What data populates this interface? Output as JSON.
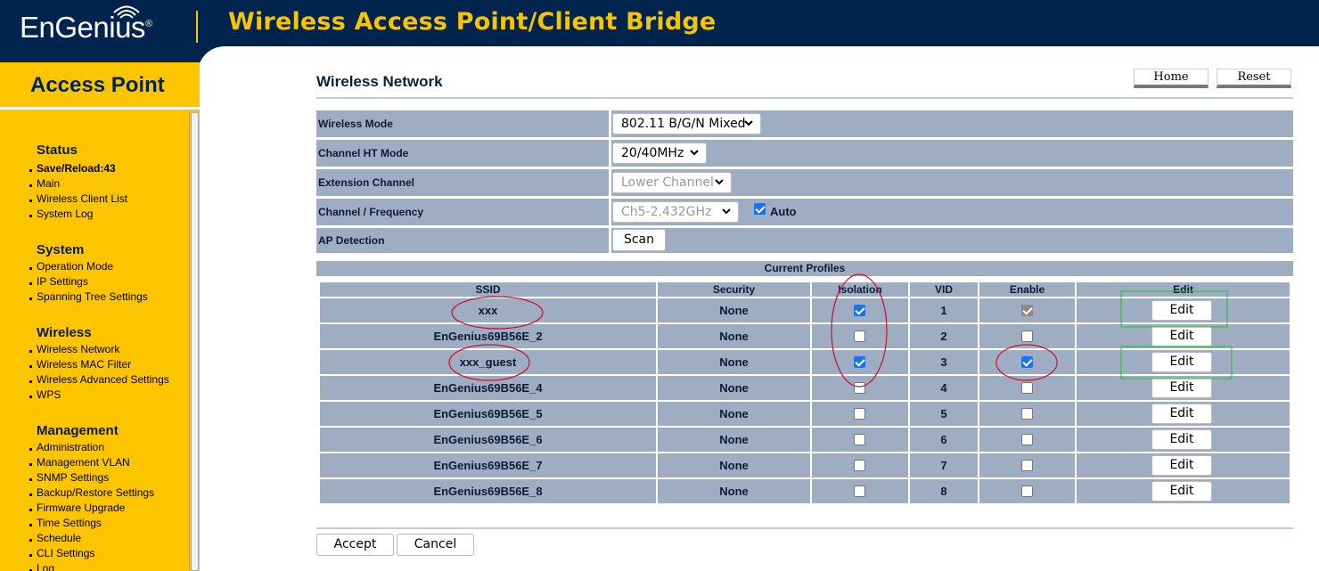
{
  "brand": {
    "logo": "EnGenius",
    "logo_reg": "®"
  },
  "header": {
    "title": "Wireless Access Point/Client Bridge"
  },
  "sidebar": {
    "mode_title": "Access Point",
    "sections": [
      {
        "title": "Status",
        "items": [
          "Save/Reload:43",
          "Main",
          "Wireless Client List",
          "System Log"
        ]
      },
      {
        "title": "System",
        "items": [
          "Operation Mode",
          "IP Settings",
          "Spanning Tree Settings"
        ]
      },
      {
        "title": "Wireless",
        "items": [
          "Wireless Network",
          "Wireless MAC Filter",
          "Wireless Advanced Settings",
          "WPS"
        ]
      },
      {
        "title": "Management",
        "items": [
          "Administration",
          "Management VLAN",
          "SNMP Settings",
          "Backup/Restore Settings",
          "Firmware Upgrade",
          "Time Settings",
          "Schedule",
          "CLI Settings",
          "Log"
        ]
      }
    ]
  },
  "page": {
    "title": "Wireless Network",
    "home_button": "Home",
    "reset_button": "Reset"
  },
  "form": {
    "wireless_mode": {
      "label": "Wireless Mode",
      "value": "802.11 B/G/N Mixed"
    },
    "channel_ht_mode": {
      "label": "Channel HT Mode",
      "value": "20/40MHz"
    },
    "extension_channel": {
      "label": "Extension Channel",
      "value": "Lower Channel"
    },
    "channel_frequency": {
      "label": "Channel / Frequency",
      "value": "Ch5-2.432GHz",
      "auto_label": "Auto",
      "auto_checked": true
    },
    "ap_detection": {
      "label": "AP Detection",
      "button": "Scan"
    }
  },
  "profiles": {
    "title": "Current Profiles",
    "columns": [
      "SSID",
      "Security",
      "Isolation",
      "VID",
      "Enable",
      "Edit"
    ],
    "edit_label": "Edit",
    "rows": [
      {
        "ssid": "xxx",
        "security": "None",
        "isolation": true,
        "vid": "1",
        "enable": true,
        "enable_locked": true
      },
      {
        "ssid": "EnGenius69B56E_2",
        "security": "None",
        "isolation": false,
        "vid": "2",
        "enable": false
      },
      {
        "ssid": "xxx_guest",
        "security": "None",
        "isolation": true,
        "vid": "3",
        "enable": true
      },
      {
        "ssid": "EnGenius69B56E_4",
        "security": "None",
        "isolation": false,
        "vid": "4",
        "enable": false
      },
      {
        "ssid": "EnGenius69B56E_5",
        "security": "None",
        "isolation": false,
        "vid": "5",
        "enable": false
      },
      {
        "ssid": "EnGenius69B56E_6",
        "security": "None",
        "isolation": false,
        "vid": "6",
        "enable": false
      },
      {
        "ssid": "EnGenius69B56E_7",
        "security": "None",
        "isolation": false,
        "vid": "7",
        "enable": false
      },
      {
        "ssid": "EnGenius69B56E_8",
        "security": "None",
        "isolation": false,
        "vid": "8",
        "enable": false
      }
    ]
  },
  "actions": {
    "accept": "Accept",
    "cancel": "Cancel"
  },
  "colors": {
    "navy": "#00244e",
    "yellow": "#fdc500",
    "row_bg": "#9fadc3",
    "annotation_red": "#c8102e",
    "annotation_green": "#22c02a"
  }
}
